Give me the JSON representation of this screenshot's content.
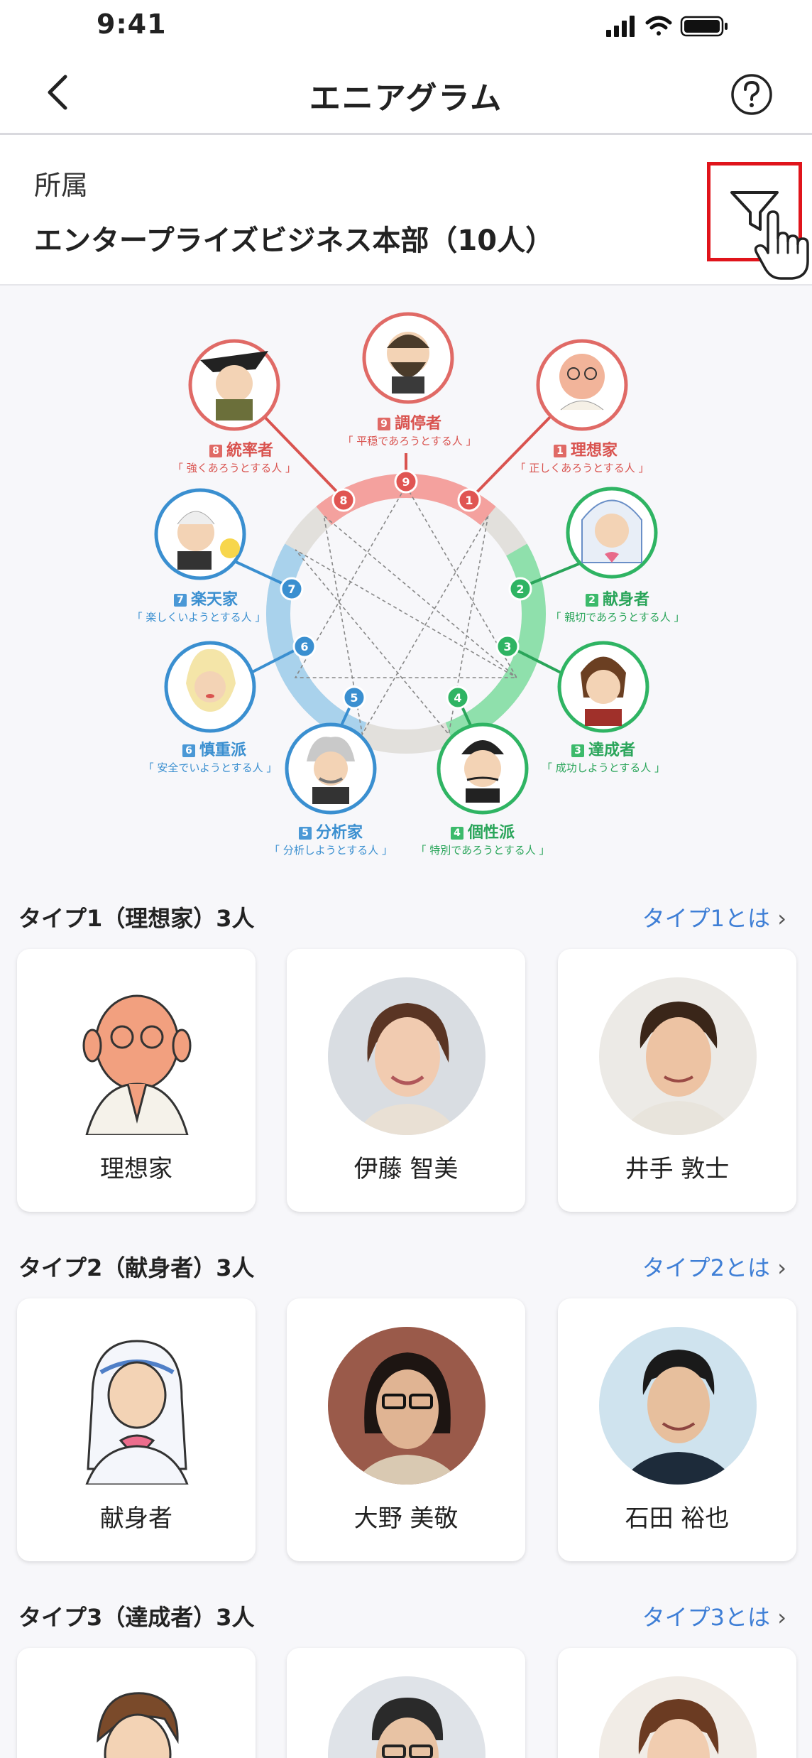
{
  "status": {
    "time": "9:41"
  },
  "nav": {
    "title": "エニアグラム"
  },
  "department": {
    "label": "所属",
    "name": "エンタープライズビジネス本部（10人）"
  },
  "diagram": {
    "types": [
      {
        "num": "1",
        "name": "理想家",
        "desc": "「 正しくあろうとする人 」",
        "color": "#d9534f"
      },
      {
        "num": "2",
        "name": "献身者",
        "desc": "「 親切であろうとする人 」",
        "color": "#2aa55a"
      },
      {
        "num": "3",
        "name": "達成者",
        "desc": "「 成功しようとする人 」",
        "color": "#2aa55a"
      },
      {
        "num": "4",
        "name": "個性派",
        "desc": "「 特別であろうとする人 」",
        "color": "#2aa55a"
      },
      {
        "num": "5",
        "name": "分析家",
        "desc": "「 分析しようとする人 」",
        "color": "#3a8fd0"
      },
      {
        "num": "6",
        "name": "慎重派",
        "desc": "「 安全でいようとする人 」",
        "color": "#3a8fd0"
      },
      {
        "num": "7",
        "name": "楽天家",
        "desc": "「 楽しくいようとする人 」",
        "color": "#3a8fd0"
      },
      {
        "num": "8",
        "name": "統率者",
        "desc": "「 強くあろうとする人 」",
        "color": "#d9534f"
      },
      {
        "num": "9",
        "name": "調停者",
        "desc": "「 平穏であろうとする人 」",
        "color": "#d9534f"
      }
    ]
  },
  "sections": [
    {
      "title": "タイプ1（理想家）3人",
      "link": "タイプ1とは",
      "cards": [
        {
          "name": "理想家",
          "kind": "illustration"
        },
        {
          "name": "伊藤 智美",
          "kind": "photo"
        },
        {
          "name": "井手 敦士",
          "kind": "photo"
        }
      ]
    },
    {
      "title": "タイプ2（献身者）3人",
      "link": "タイプ2とは",
      "cards": [
        {
          "name": "献身者",
          "kind": "illustration"
        },
        {
          "name": "大野 美敬",
          "kind": "photo"
        },
        {
          "name": "石田 裕也",
          "kind": "photo"
        }
      ]
    },
    {
      "title": "タイプ3（達成者）3人",
      "link": "タイプ3とは",
      "cards": [
        {
          "name": "",
          "kind": "illustration"
        },
        {
          "name": "",
          "kind": "photo"
        },
        {
          "name": "",
          "kind": "photo"
        }
      ]
    }
  ],
  "colors": {
    "accent_red": "#e0141b",
    "link_blue": "#3f7fd6",
    "ring_red": "#f08a88",
    "ring_green": "#7ed9a0",
    "ring_blue": "#9ccbe8",
    "ring_gray": "#e2e0dc"
  }
}
